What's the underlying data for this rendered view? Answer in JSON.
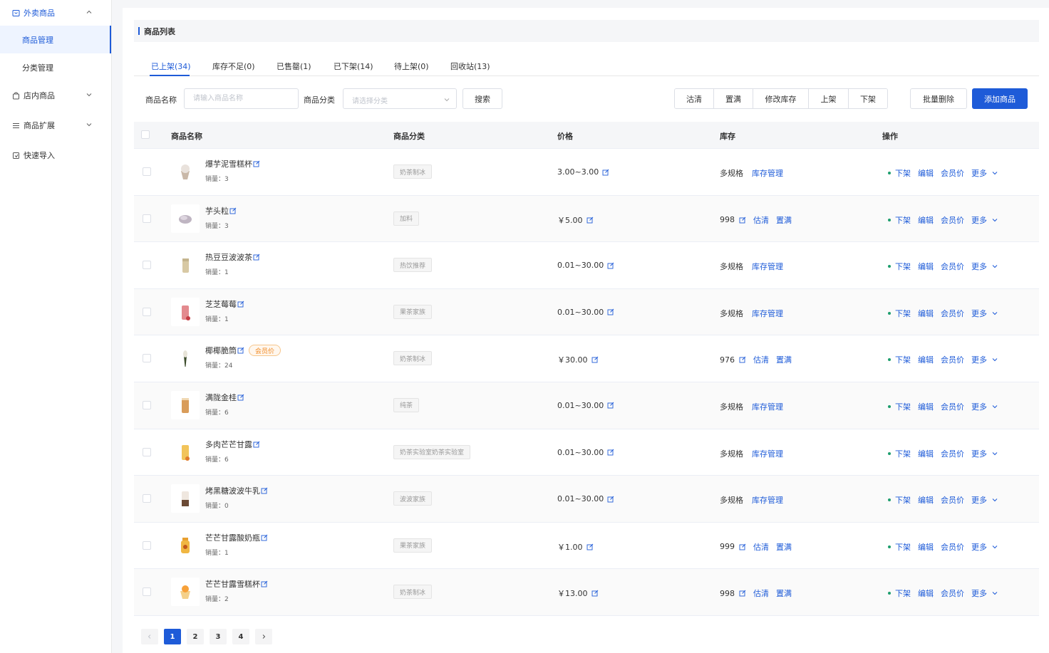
{
  "sidebar": {
    "groups": [
      {
        "label": "外卖商品",
        "icon": "takeout-box-icon",
        "expanded": true
      },
      {
        "label": "店内商品",
        "icon": "shopping-bag-icon",
        "expanded": false
      },
      {
        "label": "商品扩展",
        "icon": "list-icon",
        "expanded": false
      },
      {
        "label": "快速导入",
        "icon": "import-icon",
        "expanded": false
      }
    ],
    "subitems": [
      "商品管理",
      "分类管理"
    ]
  },
  "main": {
    "title": "商品列表",
    "tabs": [
      "已上架(34)",
      "库存不足(0)",
      "已售罄(1)",
      "已下架(14)",
      "待上架(0)",
      "回收站(13)"
    ],
    "filters": {
      "name_label": "商品名称",
      "name_placeholder": "请输入商品名称",
      "category_label": "商品分类",
      "category_placeholder": "请选择分类",
      "search_button": "搜索"
    },
    "group_buttons": [
      "沽清",
      "置满",
      "修改库存",
      "上架",
      "下架"
    ],
    "batch_delete": "批量删除",
    "add_product": "添加商品"
  },
  "table": {
    "columns": [
      "商品名称",
      "商品分类",
      "价格",
      "库存",
      "操作"
    ],
    "sales_label": "销量：",
    "stock_manage": "库存管理",
    "estimate": "估清",
    "fill": "置满",
    "ops": [
      "下架",
      "编辑",
      "会员价",
      "更多"
    ],
    "rows": [
      {
        "name": "爆芋泥雪糕杯",
        "sales": "3",
        "category": "奶茶制冰",
        "price": "3.00~3.00",
        "stock": "多规格",
        "multi": true,
        "vip": "",
        "product": "ice-cream-cup"
      },
      {
        "name": "芋头粒",
        "sales": "3",
        "category": "加料",
        "price": "￥5.00",
        "stock": "998",
        "multi": false,
        "vip": "",
        "product": "taro-bits"
      },
      {
        "name": "热豆豆波波茶",
        "sales": "1",
        "category": "热饮推荐",
        "price": "0.01~30.00",
        "stock": "多规格",
        "multi": true,
        "vip": "",
        "product": "hot-tea"
      },
      {
        "name": "芝芝莓莓",
        "sales": "1",
        "category": "果茶家族",
        "price": "0.01~30.00",
        "stock": "多规格",
        "multi": true,
        "vip": "",
        "product": "strawberry-drink"
      },
      {
        "name": "椰椰脆筒",
        "sales": "24",
        "category": "奶茶制冰",
        "price": "￥30.00",
        "stock": "976",
        "multi": false,
        "vip": "会员价",
        "product": "cone"
      },
      {
        "name": "满陇金桂",
        "sales": "6",
        "category": "纯茶",
        "price": "0.01~30.00",
        "stock": "多规格",
        "multi": true,
        "vip": "",
        "product": "osmanthus-tea"
      },
      {
        "name": "多肉芒芒甘露",
        "sales": "6",
        "category": "奶茶实验室奶茶实验室",
        "price": "0.01~30.00",
        "stock": "多规格",
        "multi": true,
        "vip": "",
        "product": "mango-drink"
      },
      {
        "name": "烤黑糖波波牛乳",
        "sales": "0",
        "category": "波波家族",
        "price": "0.01~30.00",
        "stock": "多规格",
        "multi": true,
        "vip": "",
        "product": "brown-sugar-milk"
      },
      {
        "name": "芒芒甘露酸奶瓶",
        "sales": "1",
        "category": "果茶家族",
        "price": "￥1.00",
        "stock": "999",
        "multi": false,
        "vip": "",
        "product": "mango-yogurt"
      },
      {
        "name": "芒芒甘露雪糕杯",
        "sales": "2",
        "category": "奶茶制冰",
        "price": "￥13.00",
        "stock": "998",
        "multi": false,
        "vip": "",
        "product": "mango-ice-cream"
      }
    ]
  },
  "pagination": {
    "pages": [
      "1",
      "2",
      "3",
      "4"
    ],
    "current": "1"
  },
  "colors": {
    "accent": "#1e5bd8",
    "status_dot": "#1e9e6e",
    "vip_tag": "#f08a24"
  }
}
